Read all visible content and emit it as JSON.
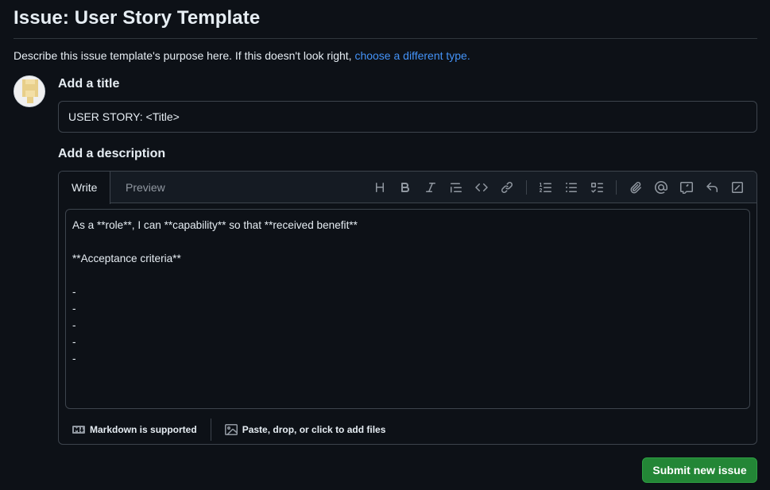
{
  "header": {
    "title": "Issue: User Story Template",
    "intro_text": "Describe this issue template's purpose here. If this doesn't look right, ",
    "intro_link": "choose a different type."
  },
  "form": {
    "title_label": "Add a title",
    "title_value": "USER STORY: <Title>",
    "description_label": "Add a description",
    "tabs": [
      "Write",
      "Preview"
    ],
    "toolbar_icons": [
      "heading-icon",
      "bold-icon",
      "italic-icon",
      "quote-icon",
      "code-icon",
      "link-icon",
      "ordered-list-icon",
      "unordered-list-icon",
      "task-list-icon",
      "attach-icon",
      "mention-icon",
      "reference-icon",
      "undo-icon",
      "fullscreen-icon"
    ],
    "description_value": "As a **role**, I can **capability** so that **received benefit**\n\n**Acceptance criteria**\n\n-\n-\n-\n-\n-",
    "markdown_note": "Markdown is supported",
    "attach_note": "Paste, drop, or click to add files"
  },
  "actions": {
    "submit_label": "Submit new issue"
  },
  "colors": {
    "background": "#0d1117",
    "link": "#4493f8",
    "submit": "#238636"
  }
}
